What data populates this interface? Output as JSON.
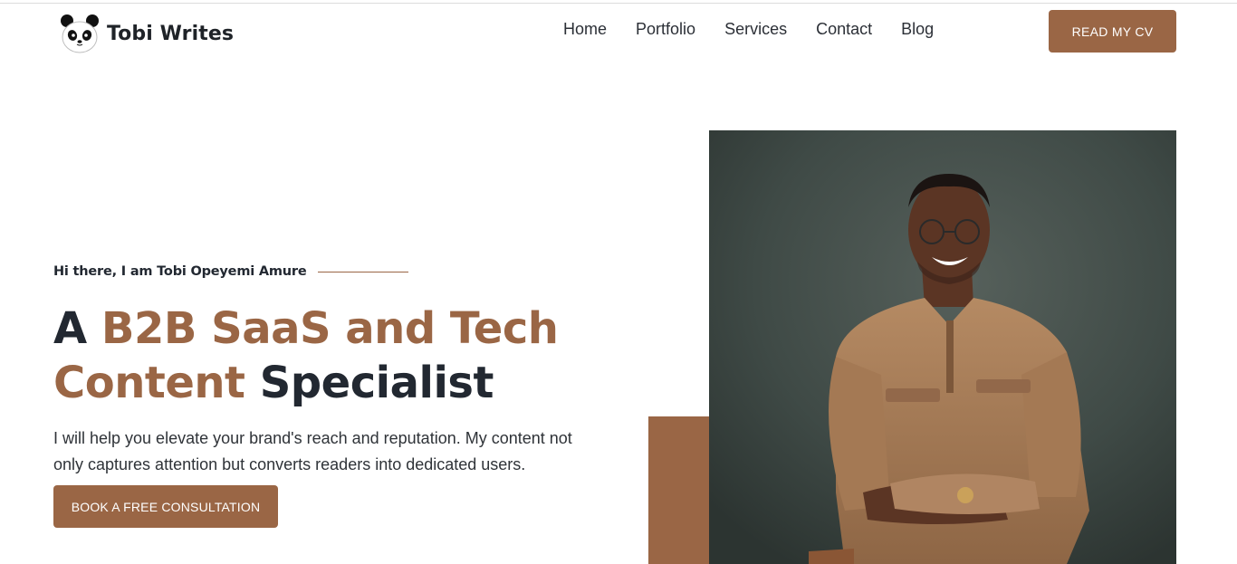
{
  "header": {
    "logo_text": "Tobi Writes",
    "nav": [
      "Home",
      "Portfolio",
      "Services",
      "Contact",
      "Blog"
    ],
    "cv_button": "READ MY CV"
  },
  "hero": {
    "eyebrow": "Hi there, I am Tobi Opeyemi Amure",
    "headline": {
      "part1": "A ",
      "accent1": "B2B SaaS and Tech",
      "accent2": "Content",
      "part2": " Specialist"
    },
    "lead": "I will help you elevate your brand's reach and reputation. My content not only captures attention but converts readers into dedicated users.",
    "cta": "BOOK A FREE CONSULTATION"
  },
  "colors": {
    "accent": "#9a6645",
    "text": "#222831",
    "photo_bg": "#3f4b47"
  },
  "icons": [
    "panda-logo-icon"
  ]
}
